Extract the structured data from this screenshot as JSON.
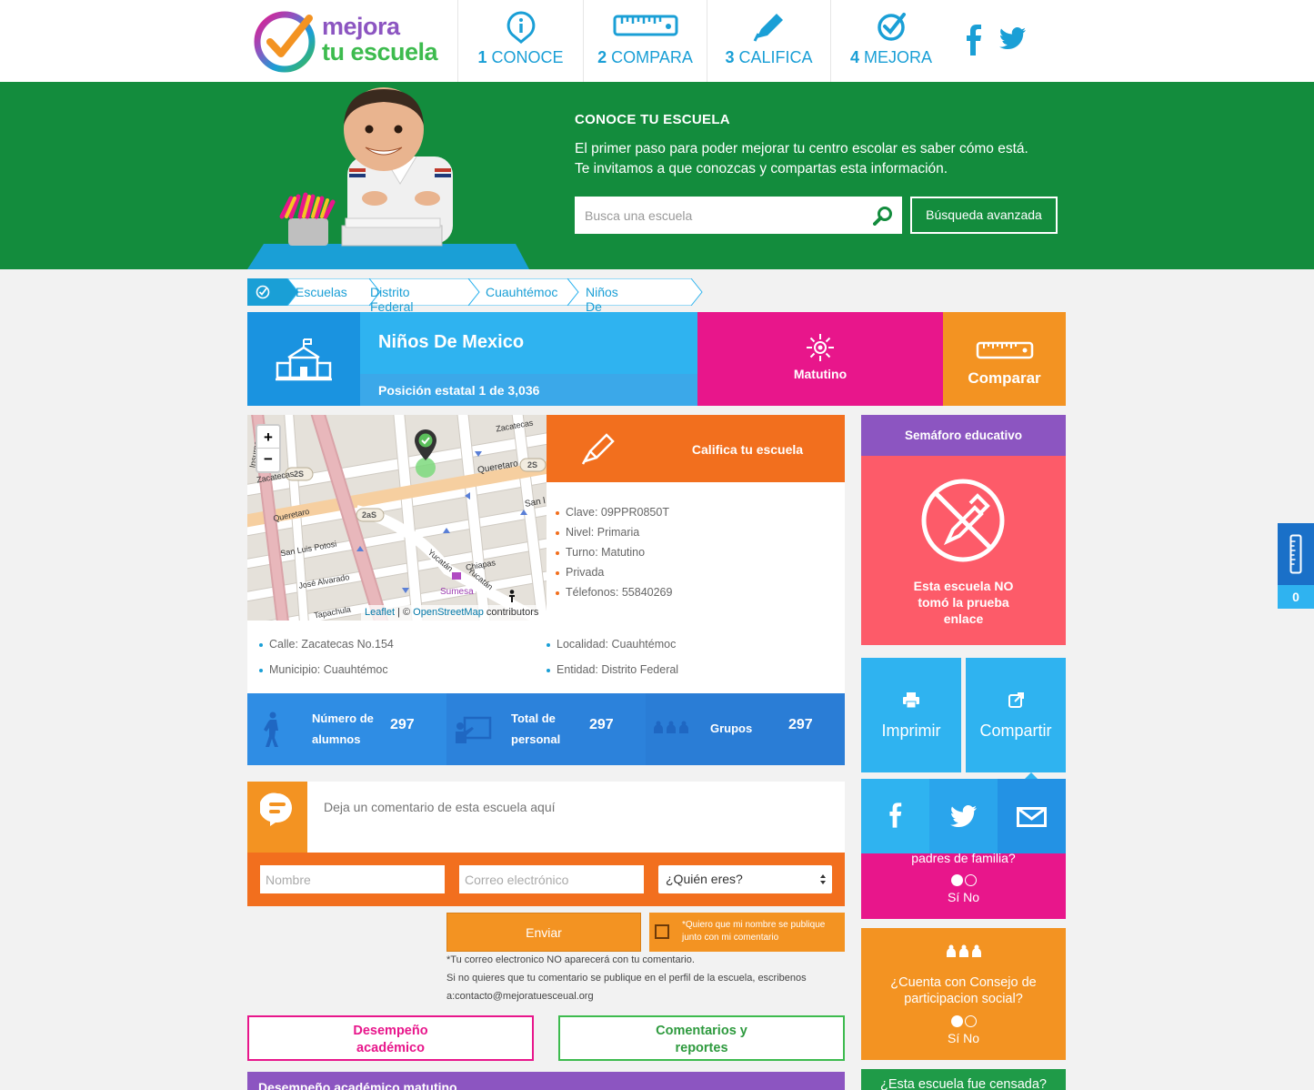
{
  "header": {
    "logo_line1": "mejora",
    "logo_line2": "tu escuela",
    "nav": [
      {
        "num": "1",
        "label": "CONOCE",
        "icon": "info-pin-icon"
      },
      {
        "num": "2",
        "label": "COMPARA",
        "icon": "ruler-icon"
      },
      {
        "num": "3",
        "label": "CALIFICA",
        "icon": "pen-icon"
      },
      {
        "num": "4",
        "label": "MEJORA",
        "icon": "check-circle-icon"
      }
    ],
    "social": [
      "facebook-icon",
      "twitter-icon"
    ]
  },
  "hero": {
    "title": "CONOCE TU ESCUELA",
    "text": "El primer paso para poder mejorar tu centro escolar es saber cómo está. Te invitamos a que conozcas y compartas esta información.",
    "search_placeholder": "Busca una escuela",
    "advanced_label": "Búsqueda avanzada"
  },
  "breadcrumb": [
    "Escuelas",
    "Distrito Federal",
    "Cuauhtémoc",
    "Niños De Mexico"
  ],
  "school": {
    "name": "Niños De Mexico",
    "rank": "Posición estatal 1 de 3,036",
    "shift": "Matutino",
    "compare_label": "Comparar",
    "rate_label": "Califica tu escuela",
    "details": [
      "Clave: 09PPR0850T",
      "Nivel: Primaria",
      "Turno: Matutino",
      "Privada",
      "Télefonos: 55840269"
    ],
    "address": {
      "street": "Calle: Zacatecas No.154",
      "locality": "Localidad: Cuauhtémoc",
      "municipality": "Municipio: Cuauhtémoc",
      "entity": "Entidad: Distrito Federal"
    }
  },
  "map": {
    "zoom_in": "+",
    "zoom_out": "−",
    "labels": [
      "Zacatecas",
      "Zacatecas",
      "Queretaro",
      "Queretaro",
      "San Luis Potosi",
      "José Alvarado",
      "Tapachula",
      "Yucatán",
      "Yucatán",
      "Chiapas",
      "Sumesa",
      "San l",
      "2S",
      "2S",
      "2aS",
      "Insurgentes"
    ],
    "attribution_leaflet": "Leaflet",
    "attribution_sep": " | © ",
    "attribution_osm": "OpenStreetMap",
    "attribution_tail": " contributors"
  },
  "stats": [
    {
      "label_1": "Número de",
      "label_2": "alumnos",
      "value": "297",
      "icon": "walking-student-icon"
    },
    {
      "label_1": "Total de",
      "label_2": "personal",
      "value": "297",
      "icon": "teacher-board-icon"
    },
    {
      "label_1": "Grupos",
      "label_2": "",
      "value": "297",
      "icon": "group-icon"
    }
  ],
  "comments": {
    "placeholder": "Deja un comentario de esta escuela aquí",
    "name_placeholder": "Nombre",
    "email_placeholder": "Correo electrónico",
    "who_label": "¿Quién eres?",
    "send_label": "Enviar",
    "publish_note": "*Quiero que mi nombre se publique junto con mi comentario",
    "email_note": "*Tu correo electronico NO aparecerá con tu comentario.",
    "remove_note_1": "Si no quieres que tu comentario se publique en el perfil de la escuela, escribenos",
    "remove_note_2": "a:contacto@mejoratuesceual.org"
  },
  "tabs": {
    "academic_1": "Desempeño",
    "academic_2": "académico",
    "comments_1": "Comentarios y",
    "comments_2": "reportes",
    "section_title": "Desempeño académico matutino"
  },
  "sidebar": {
    "semaforo_title": "Semáforo educativo",
    "semaforo_text_1": "Esta escuela NO",
    "semaforo_text_2": "tomó la prueba",
    "semaforo_text_3": "enlace",
    "print_label": "Imprimir",
    "share_label": "Compartir",
    "parents_q": "padres de familia?",
    "yes_no": "Sí No",
    "council_q_1": "¿Cuenta con Consejo de",
    "council_q_2": "participacion social?",
    "census_q": "¿Esta escuela fue censada?",
    "compare_count": "0"
  },
  "colors": {
    "brand_blue": "#1a9fd6",
    "hero_green": "#138c3d",
    "magenta": "#e8168b",
    "orange": "#f39322",
    "orange_dark": "#f26f1e",
    "purple": "#8c55c1",
    "red": "#fd5b69"
  }
}
